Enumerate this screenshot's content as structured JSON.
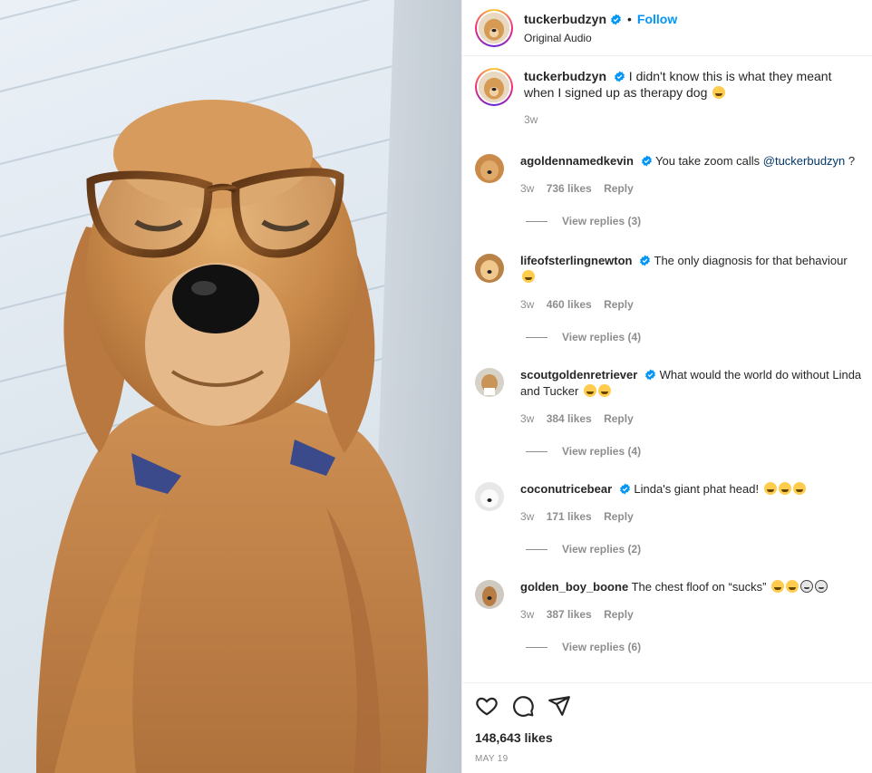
{
  "post": {
    "username": "tuckerbudzyn",
    "follow_label": "Follow",
    "dot": "•",
    "audio": "Original Audio"
  },
  "caption": {
    "username": "tuckerbudzyn",
    "text": "I didn't know this is what they meant when I signed up as therapy dog",
    "age": "3w"
  },
  "comments": [
    {
      "username": "agoldennamedkevin",
      "text": "You take zoom calls",
      "mention": "@tuckerbudzyn",
      "suffix": " ?",
      "age": "3w",
      "likes": "736 likes",
      "reply": "Reply",
      "view_replies": "View replies (3)"
    },
    {
      "username": "lifeofsterlingnewton",
      "text": "The only diagnosis for that behaviour",
      "age": "3w",
      "likes": "460 likes",
      "reply": "Reply",
      "view_replies": "View replies (4)"
    },
    {
      "username": "scoutgoldenretriever",
      "text": "What would the world do without Linda and Tucker",
      "age": "3w",
      "likes": "384 likes",
      "reply": "Reply",
      "view_replies": "View replies (4)"
    },
    {
      "username": "coconutricebear",
      "text": "Linda's giant phat head!",
      "age": "3w",
      "likes": "171 likes",
      "reply": "Reply",
      "view_replies": "View replies (2)"
    },
    {
      "username": "golden_boy_boone",
      "text": "The chest floof on “sucks”",
      "age": "3w",
      "likes": "387 likes",
      "reply": "Reply",
      "view_replies": "View replies (6)"
    }
  ],
  "footer": {
    "likes": "148,643 likes",
    "date": "MAY 19"
  },
  "icons": {
    "like": "heart-icon",
    "comment": "comment-icon",
    "share": "share-icon",
    "verified": "verified-badge-icon"
  },
  "colors": {
    "accent": "#0095f6",
    "text": "#262626",
    "muted": "#8e8e8e",
    "mention": "#00376b"
  }
}
